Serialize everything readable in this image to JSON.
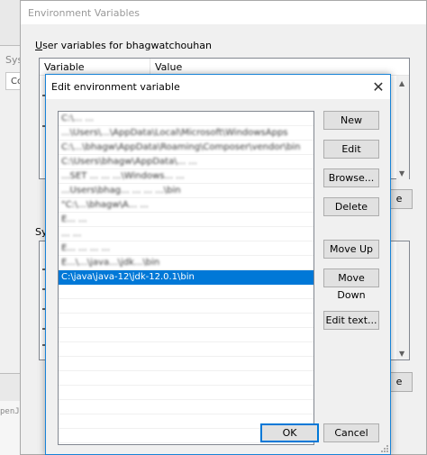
{
  "background_editor": {
    "text": "penJ"
  },
  "system_properties": {
    "title": "Sys",
    "tab_label": "Co"
  },
  "env_window": {
    "title": "Environment Variables",
    "user_section_label_prefix": "U",
    "user_section_label_rest": "ser variables for bhagwatchouhan",
    "columns": {
      "variable": "Variable",
      "value": "Value"
    },
    "system_section_label": "Sy",
    "button_right_1": "e",
    "button_right_2": "e"
  },
  "dialog": {
    "title": "Edit environment variable",
    "close_glyph": "✕",
    "entries": [
      {
        "text": "C:\\...   ...   ",
        "obscured": true
      },
      {
        "text": "...\\Users\\...\\AppData\\Local\\Microsoft\\WindowsApps",
        "obscured": true
      },
      {
        "text": "C:\\...\\bhagw\\AppData\\Roaming\\Composer\\vendor\\bin",
        "obscured": true
      },
      {
        "text": "C:\\Users\\bhagw\\AppData\\...   ...",
        "obscured": true
      },
      {
        "text": "...SET   ...   ...   ...\\Windows...   ...",
        "obscured": true
      },
      {
        "text": "...Users\\bhag...   ...   ...   ...\\bin",
        "obscured": true
      },
      {
        "text": "\"C:\\...\\bhagw\\A...   ...",
        "obscured": true
      },
      {
        "text": "E...   ...",
        "obscured": true
      },
      {
        "text": "...   ...",
        "obscured": true
      },
      {
        "text": "E...   ...   ...   ...",
        "obscured": true
      },
      {
        "text": "E...\\...\\java...\\jdk...\\bin",
        "obscured": true
      },
      {
        "text": "C:\\java\\java-12\\jdk-12.0.1\\bin",
        "obscured": false,
        "selected": true
      },
      {
        "text": "",
        "obscured": false
      },
      {
        "text": "",
        "obscured": false
      },
      {
        "text": "",
        "obscured": false
      },
      {
        "text": "",
        "obscured": false
      },
      {
        "text": "",
        "obscured": false
      },
      {
        "text": "",
        "obscured": false
      },
      {
        "text": "",
        "obscured": false
      },
      {
        "text": "",
        "obscured": false
      },
      {
        "text": "",
        "obscured": false
      },
      {
        "text": "",
        "obscured": false
      },
      {
        "text": "",
        "obscured": false
      }
    ],
    "buttons": {
      "new": "New",
      "edit": "Edit",
      "browse": "Browse...",
      "delete": "Delete",
      "move_up": "Move Up",
      "move_down": "Move Down",
      "edit_text": "Edit text...",
      "ok": "OK",
      "cancel": "Cancel"
    },
    "colors": {
      "selection": "#0078d7",
      "border_accent": "#1883d7"
    }
  }
}
